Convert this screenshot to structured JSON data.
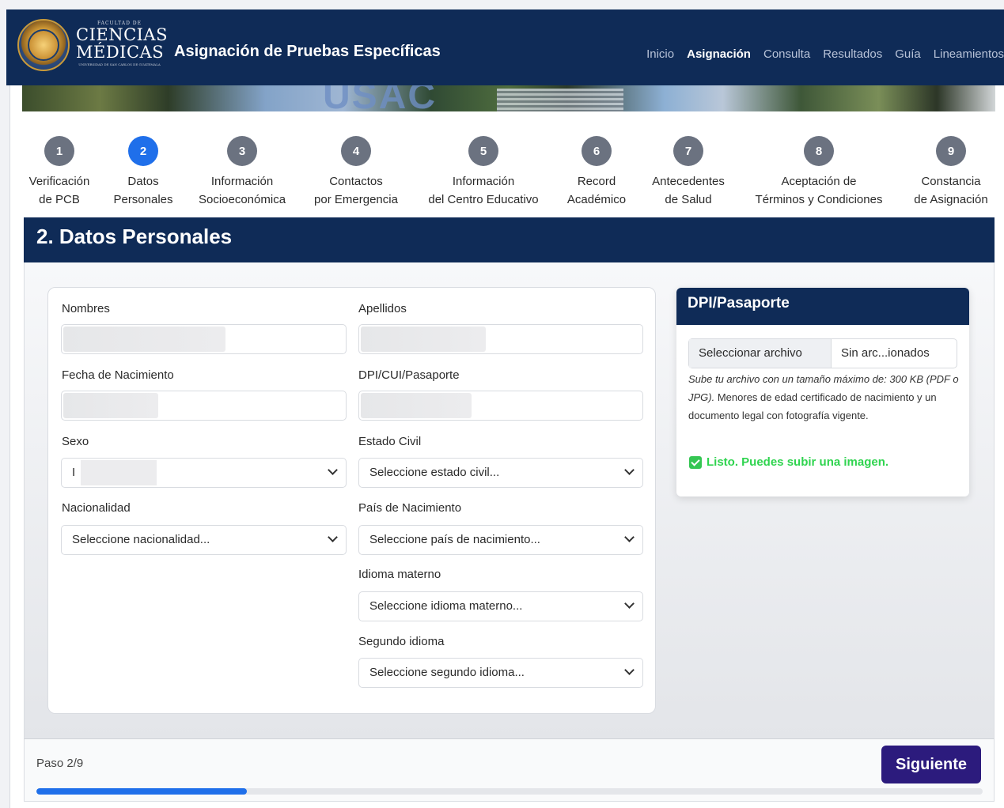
{
  "header": {
    "brand_small": "FACULTAD DE",
    "brand_line1": "CIENCIAS",
    "brand_line2": "MÉDICAS",
    "brand_tiny": "UNIVERSIDAD DE SAN CARLOS DE GUATEMALA",
    "title": "Asignación de Pruebas Específicas",
    "nav": [
      {
        "label": "Inicio",
        "active": false
      },
      {
        "label": "Asignación",
        "active": true
      },
      {
        "label": "Consulta",
        "active": false
      },
      {
        "label": "Resultados",
        "active": false
      },
      {
        "label": "Guía",
        "active": false
      },
      {
        "label": "Lineamientos",
        "active": false
      }
    ]
  },
  "banner": {
    "text": "USAC"
  },
  "steps": [
    {
      "num": "1",
      "line1": "Verificación",
      "line2": "de PCB",
      "active": false
    },
    {
      "num": "2",
      "line1": "Datos",
      "line2": "Personales",
      "active": true
    },
    {
      "num": "3",
      "line1": "Información",
      "line2": "Socioeconómica",
      "active": false
    },
    {
      "num": "4",
      "line1": "Contactos",
      "line2": "por Emergencia",
      "active": false
    },
    {
      "num": "5",
      "line1": "Información",
      "line2": "del Centro Educativo",
      "active": false
    },
    {
      "num": "6",
      "line1": "Record",
      "line2": "Académico",
      "active": false
    },
    {
      "num": "7",
      "line1": "Antecedentes",
      "line2": "de Salud",
      "active": false
    },
    {
      "num": "8",
      "line1": "Aceptación de",
      "line2": "Términos y Condiciones",
      "active": false
    },
    {
      "num": "9",
      "line1": "Constancia",
      "line2": "de Asignación",
      "active": false
    }
  ],
  "section": {
    "title": "2. Datos Personales"
  },
  "form": {
    "nombres_label": "Nombres",
    "apellidos_label": "Apellidos",
    "fecha_label": "Fecha de Nacimiento",
    "dpi_label": "DPI/CUI/Pasaporte",
    "sexo_label": "Sexo",
    "sexo_value": "I",
    "estado_label": "Estado Civil",
    "estado_value": "Seleccione estado civil...",
    "nacionalidad_label": "Nacionalidad",
    "nacionalidad_value": "Seleccione nacionalidad...",
    "pais_label": "País de Nacimiento",
    "pais_value": "Seleccione país de nacimiento...",
    "idioma_label": "Idioma materno",
    "idioma_value": "Seleccione idioma materno...",
    "segundo_label": "Segundo idioma",
    "segundo_value": "Seleccione segundo idioma..."
  },
  "dpi": {
    "title": "DPI/Pasaporte",
    "file_button": "Seleccionar archivo",
    "file_name": "Sin arc...ionados",
    "help_italic": "Sube tu archivo con un tamaño máximo de: 300 KB (PDF o JPG).",
    "help_rest": " Menores de edad certificado de nacimiento y un documento legal con fotografía vigente.",
    "status": "Listo. Puedes subir una imagen."
  },
  "footer": {
    "paso": "Paso 2/9",
    "next": "Siguiente",
    "progress_fraction": 0.222
  }
}
